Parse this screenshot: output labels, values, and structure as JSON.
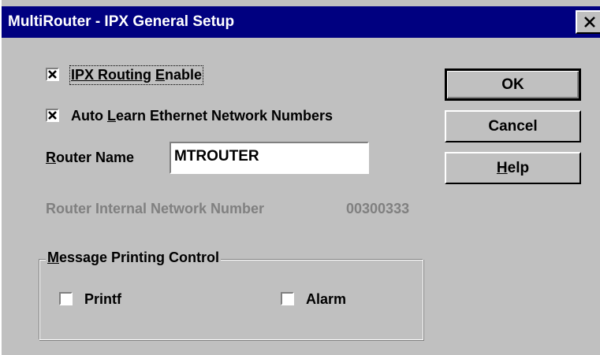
{
  "window": {
    "title": "MultiRouter - IPX General Setup",
    "close_icon": "close-x-icon"
  },
  "options": {
    "ipx_routing": {
      "label_pre": "",
      "label_mnemonic": "IPX Routing",
      "label_post": " ",
      "label_mnemonic2": "E",
      "label_post2": "nable",
      "checked": true
    },
    "auto_learn": {
      "label_pre": "Auto ",
      "label_mnemonic": "L",
      "label_post": "earn Ethernet Network Numbers",
      "checked": true
    }
  },
  "router_name": {
    "label_mnemonic": "R",
    "label_post": "outer Name",
    "value": "MTROUTER"
  },
  "internal_network": {
    "label": "Router Internal Network Number",
    "value": "00300333"
  },
  "message_printing": {
    "group_mnemonic": "M",
    "group_label_post": "essage Printing Control",
    "printf": {
      "label": "Printf",
      "checked": false
    },
    "alarm": {
      "label": "Alarm",
      "checked": false
    }
  },
  "buttons": {
    "ok": "OK",
    "cancel": "Cancel",
    "help_mnemonic": "H",
    "help_post": "elp"
  },
  "colors": {
    "titlebar": "#000080",
    "face": "#c0c0c0",
    "disabled_text": "#808080"
  }
}
